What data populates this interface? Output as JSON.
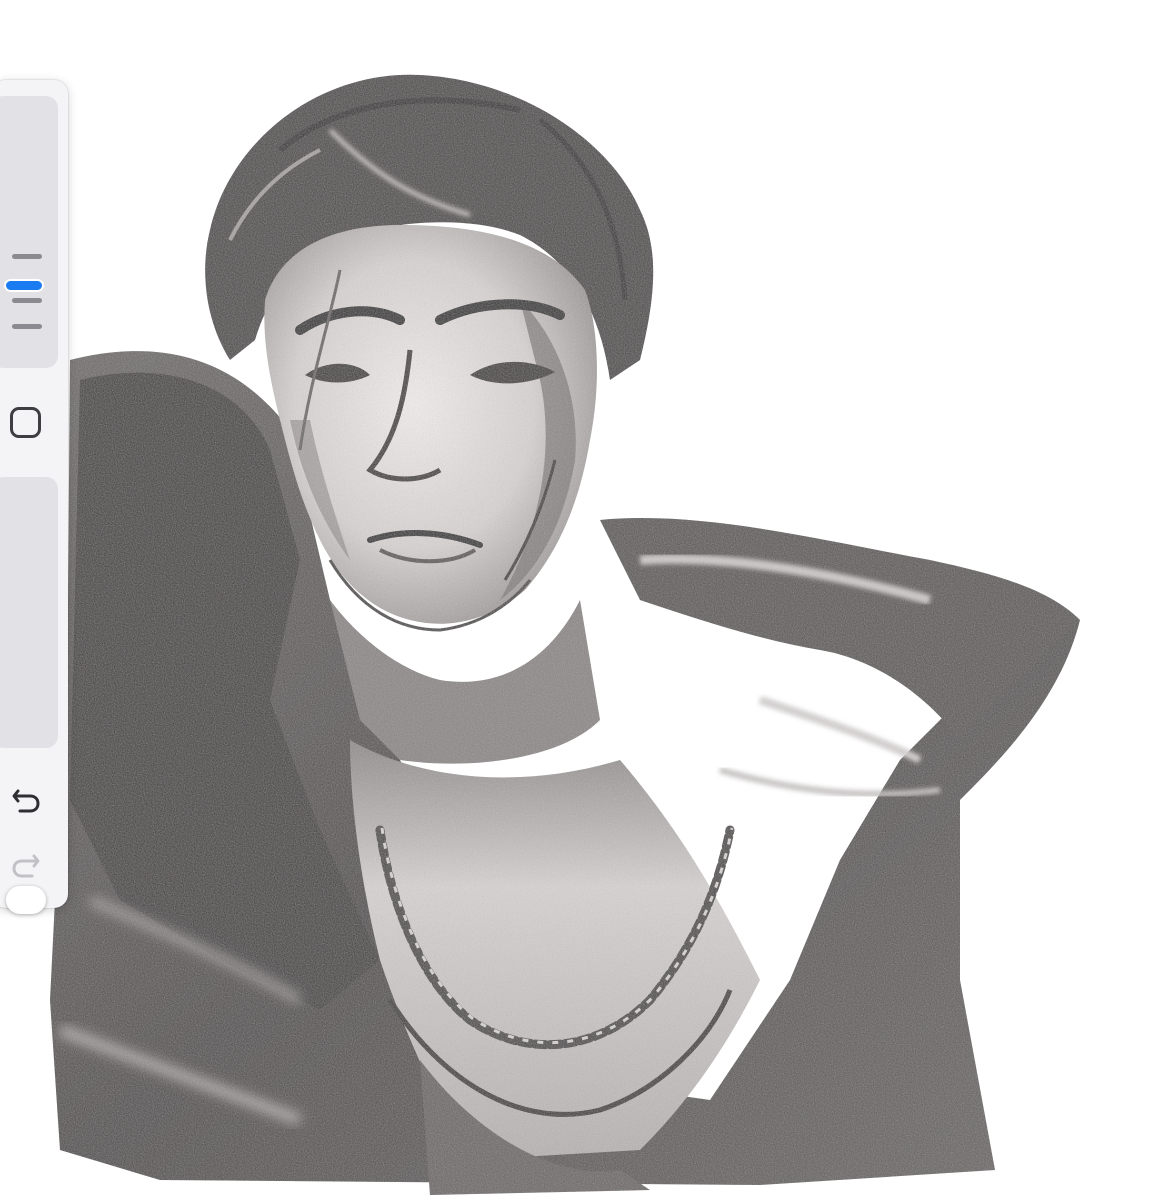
{
  "app": {
    "canvas": {
      "artwork": "graphite-portrait",
      "palette": {
        "paper": "#ffffff",
        "ink": "#3a3636",
        "dark": "#4a4545",
        "mid": "#8e8888",
        "light": "#cfcaca",
        "skin": "#e9e5e4"
      }
    },
    "sidebar": {
      "brush_size_slider": {
        "icon": "brush-size-icon",
        "accent": "#1b7cf2"
      },
      "shape_tool": {
        "icon": "square-icon"
      },
      "opacity_slider": {
        "icon": "opacity-slider-thumb"
      },
      "undo": {
        "icon": "undo-icon",
        "enabled": true
      },
      "redo": {
        "icon": "redo-icon",
        "enabled": false
      }
    }
  }
}
